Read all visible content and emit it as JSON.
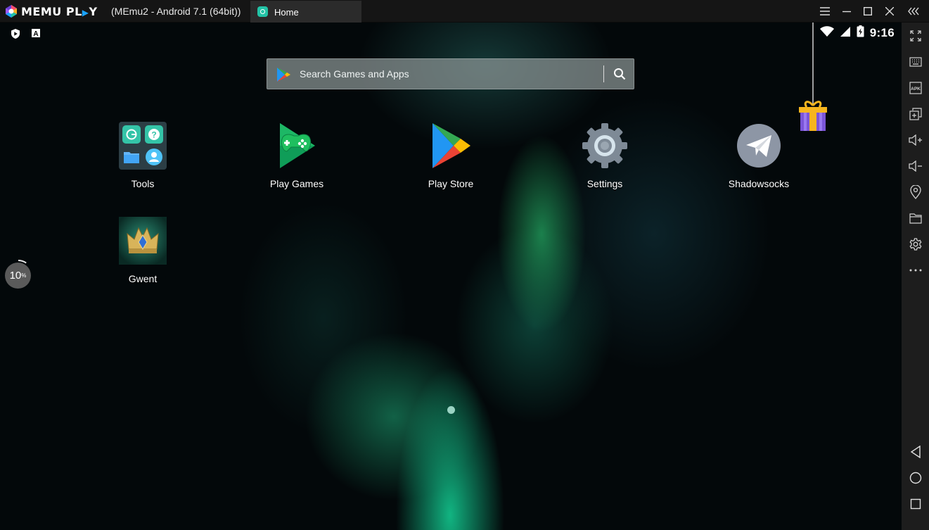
{
  "titlebar": {
    "brand_part1": "MEMU PL",
    "brand_play": "▶",
    "brand_part2": "Y",
    "window_title": "(MEmu2 - Android 7.1 (64bit))",
    "tab_label": "Home",
    "icons": [
      "menu-icon",
      "minimize-icon",
      "maximize-icon",
      "close-icon",
      "collapse-sidebar-icon"
    ]
  },
  "status": {
    "time": "9:16",
    "left_icons": [
      "play-protect-icon",
      "keyboard-a-icon"
    ],
    "right_icons": [
      "wifi-icon",
      "signal-icon",
      "battery-charging-icon"
    ]
  },
  "search": {
    "placeholder": "Search Games and Apps"
  },
  "apps": [
    {
      "label": "Tools"
    },
    {
      "label": "Play Games"
    },
    {
      "label": "Play Store"
    },
    {
      "label": "Settings"
    },
    {
      "label": "Shadowsocks"
    },
    {
      "label": "Gwent"
    }
  ],
  "progress": {
    "value": "10",
    "unit": "%",
    "fraction": 0.1
  },
  "sidebar": {
    "icons": [
      "fullscreen-icon",
      "keymapping-icon",
      "apk-install-icon",
      "multi-instance-icon",
      "volume-up-icon",
      "volume-down-icon",
      "location-icon",
      "shared-folder-icon",
      "settings-icon",
      "more-icon",
      "back-icon",
      "home-icon",
      "recents-icon"
    ],
    "apk_text": "APK"
  },
  "colors": {
    "titlebar": "#151515",
    "tab": "#2b2b2b",
    "sidebar": "#1d1d1d",
    "brand_accent": "#1aa3ff"
  }
}
